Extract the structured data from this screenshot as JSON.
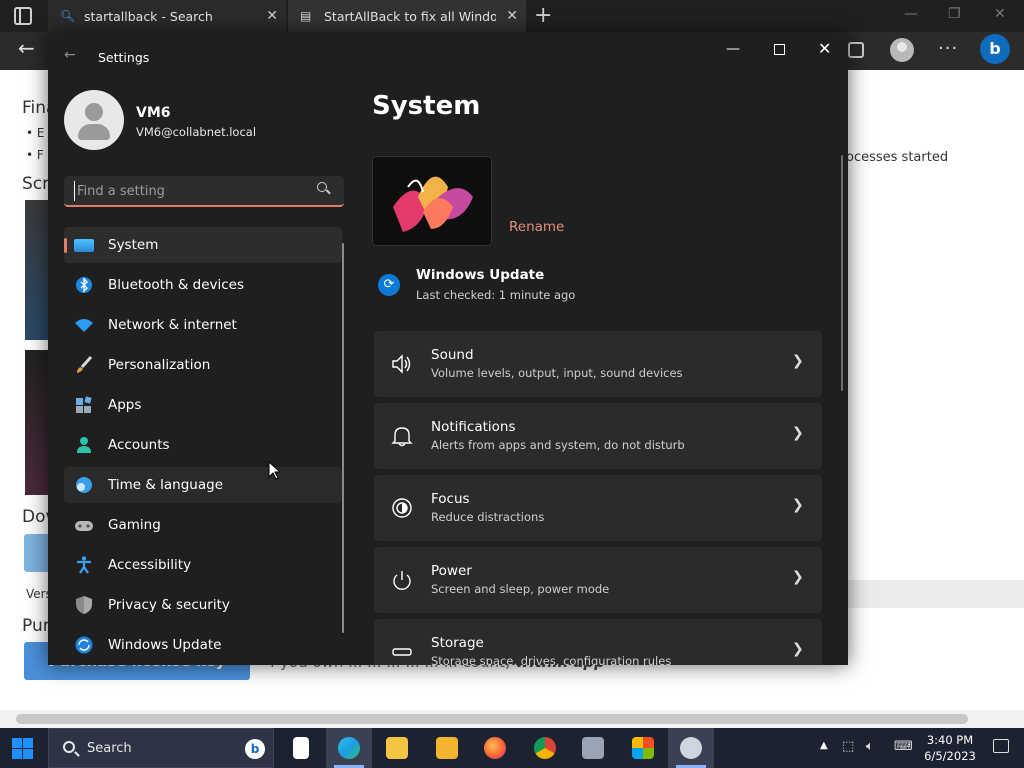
{
  "browser": {
    "tabs": [
      {
        "title": "startallback - Search",
        "icon": "search-icon"
      },
      {
        "title": "StartAllBack to fix all Windows 1",
        "icon": "page-icon"
      }
    ],
    "page": {
      "heading_final": "Fina",
      "bullet_1": "E",
      "bullet_2": "F",
      "heading_screen": "Scre",
      "heading_download": "Dov",
      "version_text": "Vers",
      "heading_purchase": "Pur",
      "purchase_button": "Purchase license key",
      "right_text": "ocesses started",
      "purchase_line_text": "f you own ... ... ... ... ... ... count)",
      "purchase_line_emph": "within app"
    }
  },
  "settings": {
    "window_title": "Settings",
    "account": {
      "name": "VM6",
      "email": "VM6@collabnet.local"
    },
    "search_placeholder": "Find a setting",
    "nav": [
      {
        "label": "System",
        "icon": "display-icon",
        "selected": true
      },
      {
        "label": "Bluetooth & devices",
        "icon": "bluetooth-icon"
      },
      {
        "label": "Network & internet",
        "icon": "wifi-icon"
      },
      {
        "label": "Personalization",
        "icon": "brush-icon"
      },
      {
        "label": "Apps",
        "icon": "apps-icon"
      },
      {
        "label": "Accounts",
        "icon": "person-icon"
      },
      {
        "label": "Time & language",
        "icon": "globe-clock-icon"
      },
      {
        "label": "Gaming",
        "icon": "gamepad-icon"
      },
      {
        "label": "Accessibility",
        "icon": "accessibility-icon"
      },
      {
        "label": "Privacy & security",
        "icon": "shield-icon"
      },
      {
        "label": "Windows Update",
        "icon": "update-icon"
      }
    ],
    "main": {
      "title": "System",
      "rename": "Rename",
      "windows_update": {
        "title": "Windows Update",
        "subtitle": "Last checked: 1 minute ago"
      },
      "cards": [
        {
          "title": "Sound",
          "subtitle": "Volume levels, output, input, sound devices",
          "icon": "speaker-icon"
        },
        {
          "title": "Notifications",
          "subtitle": "Alerts from apps and system, do not disturb",
          "icon": "bell-icon"
        },
        {
          "title": "Focus",
          "subtitle": "Reduce distractions",
          "icon": "focus-icon"
        },
        {
          "title": "Power",
          "subtitle": "Screen and sleep, power mode",
          "icon": "power-icon"
        },
        {
          "title": "Storage",
          "subtitle": "Storage space, drives, configuration rules",
          "icon": "storage-icon"
        }
      ]
    }
  },
  "taskbar": {
    "search_label": "Search",
    "apps": [
      "task-view-icon",
      "edge-icon",
      "file-explorer-icon",
      "folder-icon",
      "firefox-icon",
      "chrome-icon",
      "control-panel-icon",
      "store-icon",
      "settings-icon"
    ],
    "time": "3:40 PM",
    "date": "6/5/2023"
  },
  "colors": {
    "accent": "#e27c6c",
    "settings_bg": "#1f1f1f",
    "card_bg": "#2b2b2b",
    "taskbar_bg": "#1c2230"
  }
}
